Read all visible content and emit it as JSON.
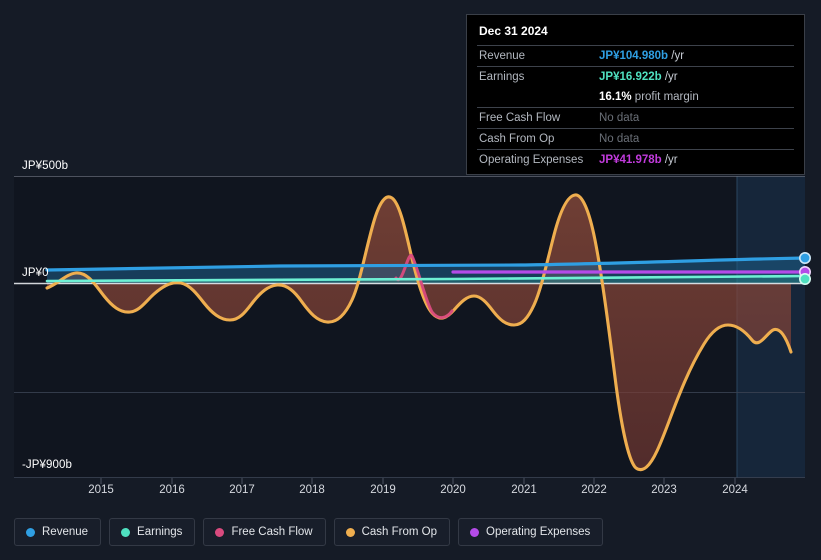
{
  "yaxis": {
    "top_label": "JP¥500b",
    "zero_label": "JP¥0",
    "bottom_label": "-JP¥900b"
  },
  "tooltip": {
    "date": "Dec 31 2024",
    "rows": [
      {
        "name": "Revenue",
        "value": "JP¥104.980b",
        "suffix": " /yr",
        "style": "rev"
      },
      {
        "name": "Earnings",
        "value": "JP¥16.922b",
        "suffix": " /yr",
        "style": "earn"
      },
      {
        "name": "",
        "value": "16.1%",
        "suffix": " profit margin",
        "style": "margin"
      },
      {
        "name": "Free Cash Flow",
        "value": "No data",
        "suffix": "",
        "style": "nodata"
      },
      {
        "name": "Cash From Op",
        "value": "No data",
        "suffix": "",
        "style": "nodata"
      },
      {
        "name": "Operating Expenses",
        "value": "JP¥41.978b",
        "suffix": " /yr",
        "style": "opex"
      }
    ]
  },
  "legend": {
    "items": [
      {
        "label": "Revenue",
        "color": "#2f9fe3"
      },
      {
        "label": "Earnings",
        "color": "#4fe0c0"
      },
      {
        "label": "Free Cash Flow",
        "color": "#d94a7e"
      },
      {
        "label": "Cash From Op",
        "color": "#efae4f"
      },
      {
        "label": "Operating Expenses",
        "color": "#b44be8"
      }
    ]
  },
  "chart_data": {
    "type": "line",
    "title": "",
    "xlabel": "",
    "ylabel": "JP¥",
    "ylim": [
      -900,
      500
    ],
    "yticks": [
      500,
      0,
      -900
    ],
    "ytick_labels": [
      "JP¥500b",
      "JP¥0",
      "-JP¥900b"
    ],
    "grid": true,
    "legend_position": "bottom",
    "x_tick_labels": [
      "2015",
      "2016",
      "2017",
      "2018",
      "2019",
      "2020",
      "2021",
      "2022",
      "2023",
      "2024"
    ],
    "x": [
      2014.3,
      2015,
      2016,
      2017,
      2018,
      2019,
      2020,
      2021,
      2022,
      2023,
      2024,
      2025.1
    ],
    "units": "JP¥ billions",
    "forecast_region_start": "2024.1",
    "series": [
      {
        "name": "Revenue",
        "color": "#2f9fe3",
        "values": [
          68,
          72,
          74,
          76,
          80,
          84,
          82,
          86,
          92,
          96,
          101,
          104.98
        ]
      },
      {
        "name": "Earnings",
        "color": "#4fe0c0",
        "values": [
          5,
          6,
          7,
          8,
          9,
          10,
          9,
          11,
          13,
          14,
          16,
          16.922
        ]
      },
      {
        "name": "Free Cash Flow",
        "color": "#d94a7e",
        "values": [
          null,
          null,
          null,
          null,
          null,
          10,
          -70,
          null,
          null,
          null,
          null,
          null
        ]
      },
      {
        "name": "Cash From Op",
        "color": "#efae4f",
        "values": [
          -55,
          35,
          -60,
          30,
          -70,
          260,
          -55,
          -20,
          330,
          -880,
          -150,
          -330
        ]
      },
      {
        "name": "Operating Expenses",
        "color": "#b44be8",
        "values": [
          null,
          null,
          null,
          null,
          null,
          null,
          38,
          39,
          40,
          40,
          41,
          41.978
        ]
      }
    ]
  }
}
